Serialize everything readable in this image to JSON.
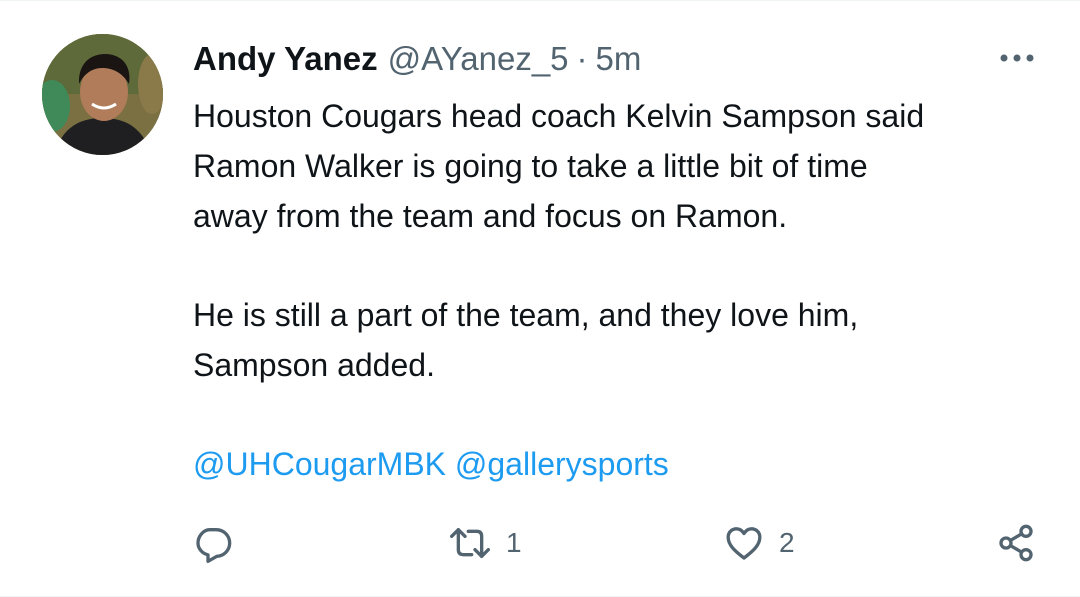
{
  "author": {
    "display_name": "Andy Yanez",
    "handle": "@AYanez_5",
    "separator": "·",
    "time": "5m",
    "avatar_icon": "user-avatar"
  },
  "tweet": {
    "paragraph1": "Houston Cougars head coach Kelvin Sampson said\nRamon Walker is going to take a little bit of time\naway from the team and focus on Ramon.",
    "paragraph2": "He is still a part of the team, and they love him,\nSampson added.",
    "mentions": [
      "@UHCougarMBK",
      "@gallerysports"
    ]
  },
  "actions": {
    "reply": {
      "icon": "reply-icon",
      "count": ""
    },
    "retweet": {
      "icon": "retweet-icon",
      "count": "1"
    },
    "like": {
      "icon": "heart-icon",
      "count": "2"
    },
    "share": {
      "icon": "share-icon"
    }
  },
  "colors": {
    "text": "#0f1419",
    "secondary": "#536471",
    "link": "#1d9bf0"
  }
}
